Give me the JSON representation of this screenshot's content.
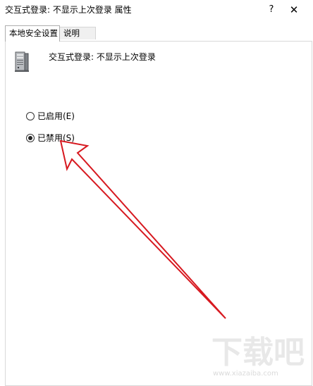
{
  "window": {
    "title": "交互式登录: 不显示上次登录 属性",
    "help_label": "?",
    "close_label": "✕"
  },
  "tabs": [
    {
      "label": "本地安全设置",
      "active": true
    },
    {
      "label": "说明",
      "active": false
    }
  ],
  "policy": {
    "name": "交互式登录: 不显示上次登录",
    "icon": "server-computer-icon"
  },
  "options": [
    {
      "label": "已启用(E)",
      "selected": false
    },
    {
      "label": "已禁用(S)",
      "selected": true
    }
  ],
  "annotation": {
    "color": "#d71920"
  },
  "watermark": {
    "text": "下载吧",
    "url": "www.xiazaiba.com"
  }
}
